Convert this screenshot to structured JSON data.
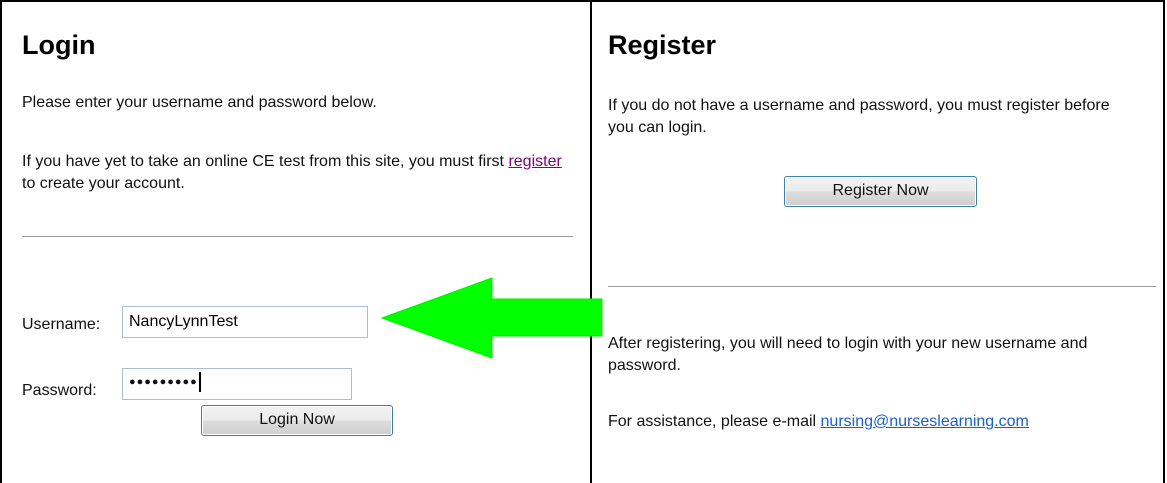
{
  "login": {
    "title": "Login",
    "intro": "Please enter your username and password below.",
    "note_before": "If you have yet to take an online CE test from this site, you must first ",
    "note_link": "register",
    "note_after": " to create your account.",
    "username_label": "Username:",
    "username_value": "NancyLynnTest",
    "password_label": "Password:",
    "password_mask": "●●●●●●●●●",
    "login_button": "Login Now"
  },
  "register": {
    "title": "Register",
    "intro": "If you do not have a username and password, you must register before you can login.",
    "register_button": "Register Now",
    "after_text": "After registering, you will need to login with your new username and password.",
    "assist_before": "For assistance, please e-mail ",
    "assist_email": "nursing@nurseslearning.com"
  },
  "annotation": {
    "arrow_color": "#00ff00"
  }
}
